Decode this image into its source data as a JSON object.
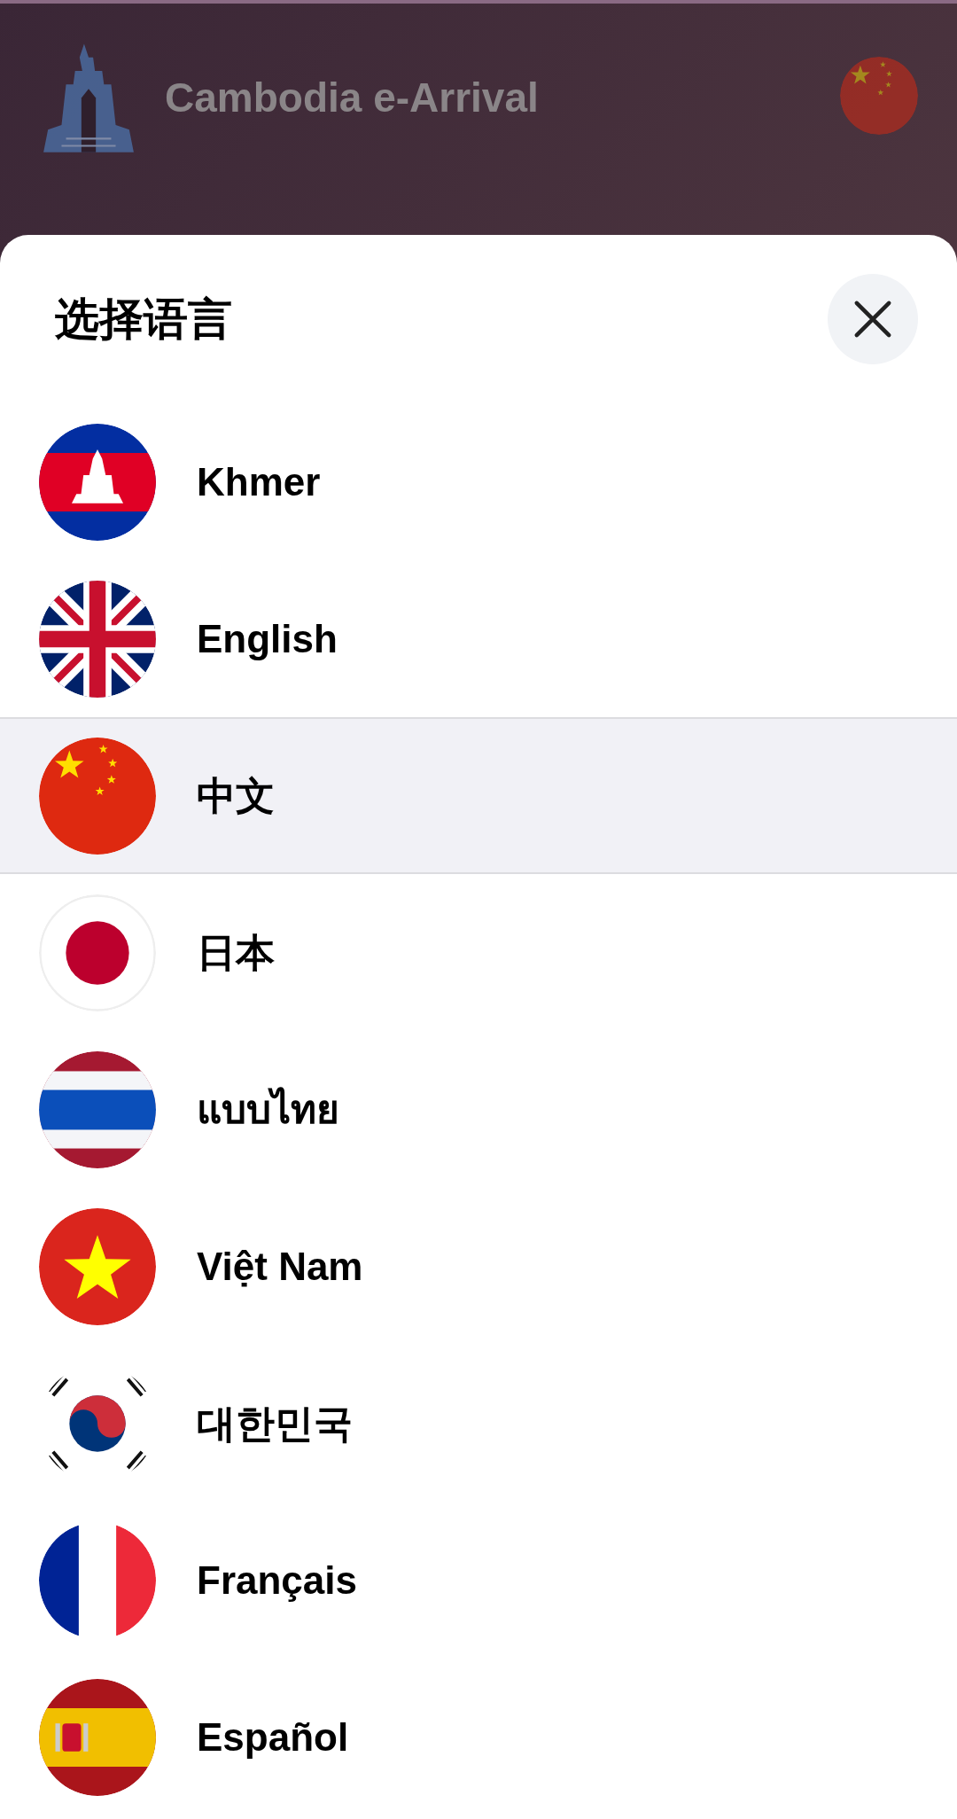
{
  "header": {
    "title": "Cambodia e-Arrival",
    "flag": {
      "kind": "china"
    }
  },
  "sheet": {
    "title": "选择语言",
    "languages": [
      {
        "label": "Khmer",
        "kind": "cambodia",
        "selected": false
      },
      {
        "label": "English",
        "kind": "uk",
        "selected": false
      },
      {
        "label": "中文",
        "kind": "china",
        "selected": true
      },
      {
        "label": "日本",
        "kind": "japan",
        "selected": false
      },
      {
        "label": "แบบไทย",
        "kind": "thailand",
        "selected": false
      },
      {
        "label": "Việt Nam",
        "kind": "vietnam",
        "selected": false
      },
      {
        "label": "대한민국",
        "kind": "korea",
        "selected": false
      },
      {
        "label": "Français",
        "kind": "france",
        "selected": false
      },
      {
        "label": "Español",
        "kind": "spain",
        "selected": false
      }
    ]
  }
}
